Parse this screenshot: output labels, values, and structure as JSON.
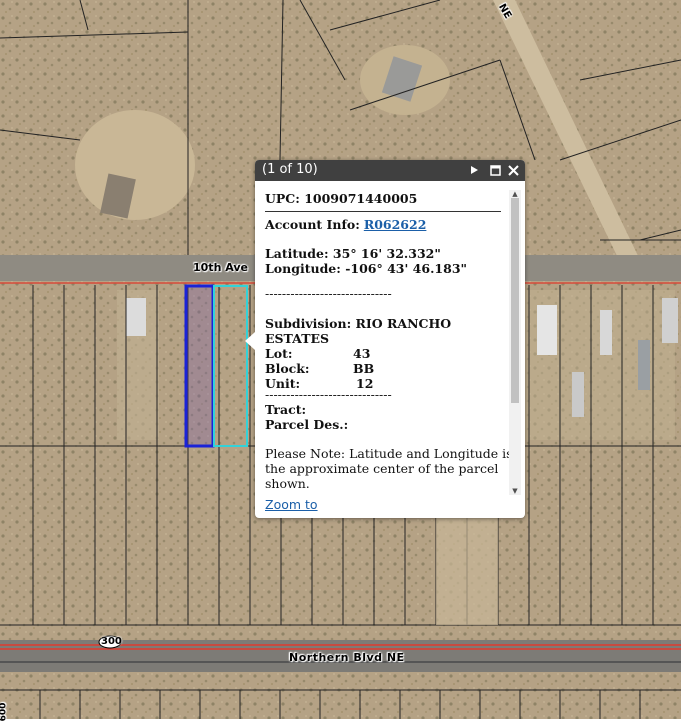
{
  "map": {
    "roads": {
      "tenth_ave": "10th Ave",
      "northern_blvd": "Northern Blvd NE",
      "route_shield": "300",
      "corner_partial": "NE",
      "bottom_left_partial": "600"
    }
  },
  "popup": {
    "title": "(1 of 10)",
    "play_icon": "play-icon",
    "maximize_icon": "maximize-icon",
    "close_icon": "close-icon",
    "upc": "UPC: 1009071440005",
    "account_label": "Account Info:",
    "account_link": "R062622",
    "latitude": "Latitude: 35° 16' 32.332\"",
    "longitude": "Longitude: -106° 43' 46.183\"",
    "separator": "------------------------------",
    "subdivision_label": "Subdivision:",
    "subdivision_value": "RIO RANCHO",
    "subdivision_value_2": "ESTATES",
    "lot_label": "Lot:",
    "lot_value": "43",
    "block_label": "Block:",
    "block_value": "BB",
    "unit_label": "Unit:",
    "unit_value": "12",
    "tract_label": "Tract:",
    "parcel_label": "Parcel Des.:",
    "note_1": "Please Note: Latitude and Longitude is",
    "note_2": "the approximate center of the parcel",
    "note_3": "shown.",
    "zoom_link": "Zoom to"
  }
}
